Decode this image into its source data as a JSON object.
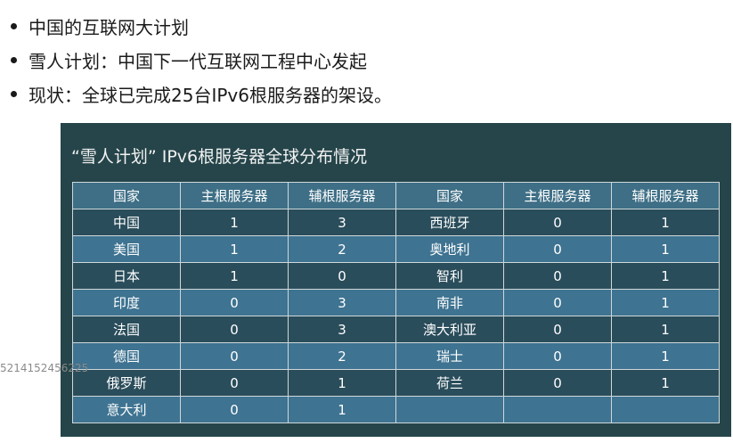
{
  "bullets": [
    "中国的互联网大计划",
    "雪人计划：中国下一代互联网工程中心发起",
    "现状：全球已完成25台IPv6根服务器的架设。"
  ],
  "table": {
    "title": "“雪人计划” IPv6根服务器全球分布情况",
    "headers": [
      "国家",
      "主根服务器",
      "辅根服务器",
      "国家",
      "主根服务器",
      "辅根服务器"
    ],
    "rows": [
      [
        "中国",
        "1",
        "3",
        "西班牙",
        "0",
        "1"
      ],
      [
        "美国",
        "1",
        "2",
        "奥地利",
        "0",
        "1"
      ],
      [
        "日本",
        "1",
        "0",
        "智利",
        "0",
        "1"
      ],
      [
        "印度",
        "0",
        "3",
        "南非",
        "0",
        "1"
      ],
      [
        "法国",
        "0",
        "3",
        "澳大利亚",
        "0",
        "1"
      ],
      [
        "德国",
        "0",
        "2",
        "瑞士",
        "0",
        "1"
      ],
      [
        "俄罗斯",
        "0",
        "1",
        "荷兰",
        "0",
        "1"
      ],
      [
        "意大利",
        "0",
        "1",
        "",
        "",
        ""
      ]
    ]
  },
  "watermark": "5214152456225",
  "colors": {
    "panel_bg": "#25454a",
    "header_bg": "#3e6f86",
    "row_dark": "#2a4d5b",
    "row_light": "#3e7391",
    "grid_line": "#cfd8da"
  }
}
